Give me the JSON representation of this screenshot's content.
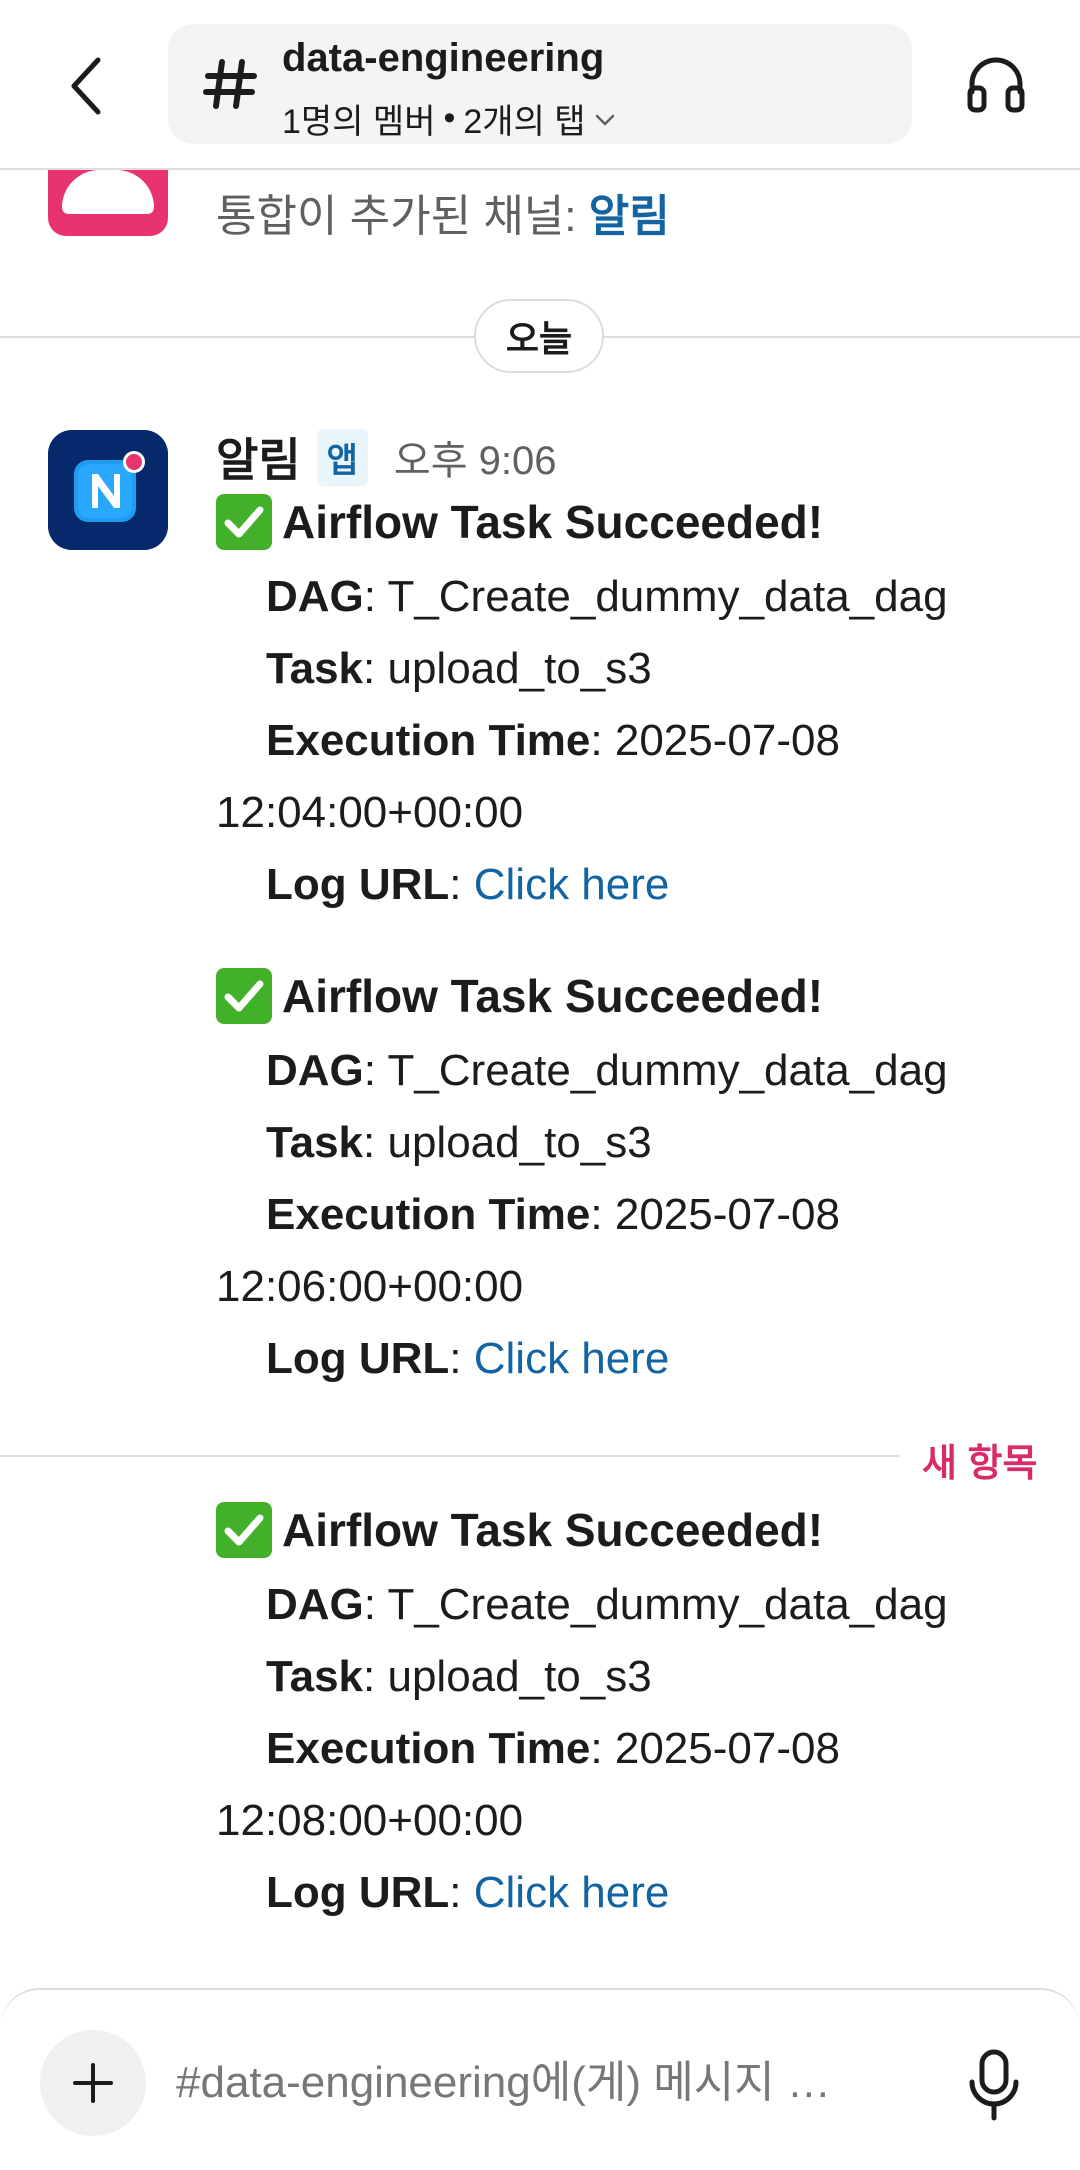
{
  "header": {
    "channel_name": "data-engineering",
    "members": "1명의 멤버",
    "separator": "•",
    "tabs": "2개의 탭"
  },
  "previous_message": {
    "text": "통합이 추가된 채널:",
    "channel": "알림"
  },
  "date_divider": "오늘",
  "message_group": {
    "sender": "알림",
    "badge": "앱",
    "time": "오후 9:06",
    "messages": [
      {
        "title": "Airflow Task Succeeded!",
        "dag_label": "DAG",
        "dag": "T_Create_dummy_data_dag",
        "task_label": "Task",
        "task": "upload_to_s3",
        "exec_label": "Execution Time",
        "exec_date": "2025-07-08",
        "exec_time": "12:04:00+00:00",
        "log_label": "Log URL",
        "log_link": "Click here"
      },
      {
        "title": "Airflow Task Succeeded!",
        "dag_label": "DAG",
        "dag": "T_Create_dummy_data_dag",
        "task_label": "Task",
        "task": "upload_to_s3",
        "exec_label": "Execution Time",
        "exec_date": "2025-07-08",
        "exec_time": "12:06:00+00:00",
        "log_label": "Log URL",
        "log_link": "Click here"
      },
      {
        "title": "Airflow Task Succeeded!",
        "dag_label": "DAG",
        "dag": "T_Create_dummy_data_dag",
        "task_label": "Task",
        "task": "upload_to_s3",
        "exec_label": "Execution Time",
        "exec_date": "2025-07-08",
        "exec_time": "12:08:00+00:00",
        "log_label": "Log URL",
        "log_link": "Click here"
      }
    ]
  },
  "new_divider_label": "새 항목",
  "composer": {
    "placeholder": "#data-engineering에(게) 메시지 …"
  },
  "icons": {
    "back": "chevron-left-icon",
    "channel": "hash-icon",
    "expand": "chevron-down-icon",
    "huddle": "headphones-icon",
    "app_avatar": "notification-app-icon",
    "check": "check-mark-icon",
    "add": "plus-icon",
    "mic": "microphone-icon"
  },
  "colors": {
    "link": "#1264a3",
    "new_label": "#d82c6a",
    "app_avatar_bg": "#06296b",
    "prev_avatar_bg": "#e8336f",
    "check_bg": "#43b02a"
  }
}
